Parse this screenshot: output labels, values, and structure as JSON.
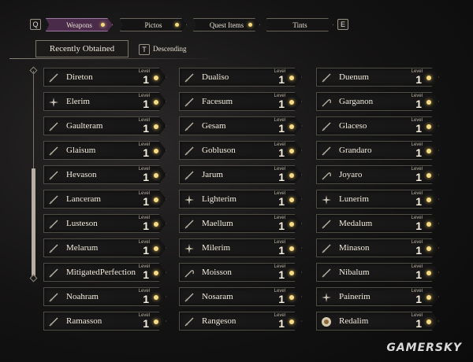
{
  "nav": {
    "left_key": "Q",
    "right_key": "E",
    "tabs": [
      {
        "label": "Weapons",
        "active": true
      },
      {
        "label": "Pictos",
        "active": false
      },
      {
        "label": "Quest Items",
        "active": false
      },
      {
        "label": "Tints",
        "active": false
      }
    ]
  },
  "sort": {
    "label": "Recently Obtained",
    "key": "T",
    "order": "Descending"
  },
  "level_label": "Level",
  "columns": [
    [
      {
        "name": "Direton",
        "level": "1",
        "icon": "blade-icon"
      },
      {
        "name": "Elerim",
        "level": "1",
        "icon": "cross-emblem-icon"
      },
      {
        "name": "Gaulteram",
        "level": "1",
        "icon": "blade-icon"
      },
      {
        "name": "Glaisum",
        "level": "1",
        "icon": "blade-icon"
      },
      {
        "name": "Hevason",
        "level": "1",
        "icon": "blade-icon"
      },
      {
        "name": "Lanceram",
        "level": "1",
        "icon": "blade-icon"
      },
      {
        "name": "Lusteson",
        "level": "1",
        "icon": "blade-icon"
      },
      {
        "name": "Melarum",
        "level": "1",
        "icon": "blade-icon"
      },
      {
        "name": "MitigatedPerfection",
        "level": "1",
        "icon": "blade-icon"
      },
      {
        "name": "Noahram",
        "level": "1",
        "icon": "blade-icon"
      },
      {
        "name": "Ramasson",
        "level": "1",
        "icon": "blade-icon"
      }
    ],
    [
      {
        "name": "Dualiso",
        "level": "1",
        "icon": "blade-icon"
      },
      {
        "name": "Facesum",
        "level": "1",
        "icon": "blade-icon"
      },
      {
        "name": "Gesam",
        "level": "1",
        "icon": "blade-icon"
      },
      {
        "name": "Gobluson",
        "level": "1",
        "icon": "blade-icon"
      },
      {
        "name": "Jarum",
        "level": "1",
        "icon": "blade-icon"
      },
      {
        "name": "Lighterim",
        "level": "1",
        "icon": "cross-emblem-icon"
      },
      {
        "name": "Maellum",
        "level": "1",
        "icon": "blade-icon"
      },
      {
        "name": "Milerim",
        "level": "1",
        "icon": "cross-emblem-icon"
      },
      {
        "name": "Moisson",
        "level": "1",
        "icon": "scythe-icon"
      },
      {
        "name": "Nosaram",
        "level": "1",
        "icon": "blade-icon"
      },
      {
        "name": "Rangeson",
        "level": "1",
        "icon": "blade-icon"
      }
    ],
    [
      {
        "name": "Duenum",
        "level": "1",
        "icon": "blade-icon"
      },
      {
        "name": "Garganon",
        "level": "1",
        "icon": "scythe-icon"
      },
      {
        "name": "Glaceso",
        "level": "1",
        "icon": "blade-icon"
      },
      {
        "name": "Grandaro",
        "level": "1",
        "icon": "blade-icon"
      },
      {
        "name": "Joyaro",
        "level": "1",
        "icon": "scythe-icon"
      },
      {
        "name": "Lunerim",
        "level": "1",
        "icon": "cross-emblem-icon"
      },
      {
        "name": "Medalum",
        "level": "1",
        "icon": "blade-icon"
      },
      {
        "name": "Minason",
        "level": "1",
        "icon": "blade-icon"
      },
      {
        "name": "Nibalum",
        "level": "1",
        "icon": "blade-icon"
      },
      {
        "name": "Painerim",
        "level": "1",
        "icon": "cross-emblem-icon"
      },
      {
        "name": "Redalim",
        "level": "1",
        "icon": "medallion-icon"
      }
    ]
  ],
  "watermark": "GAMERSKY",
  "colors": {
    "active_tab": "#4a2b4a",
    "level_star": "#f6dc86",
    "text": "#f1ebdd"
  }
}
